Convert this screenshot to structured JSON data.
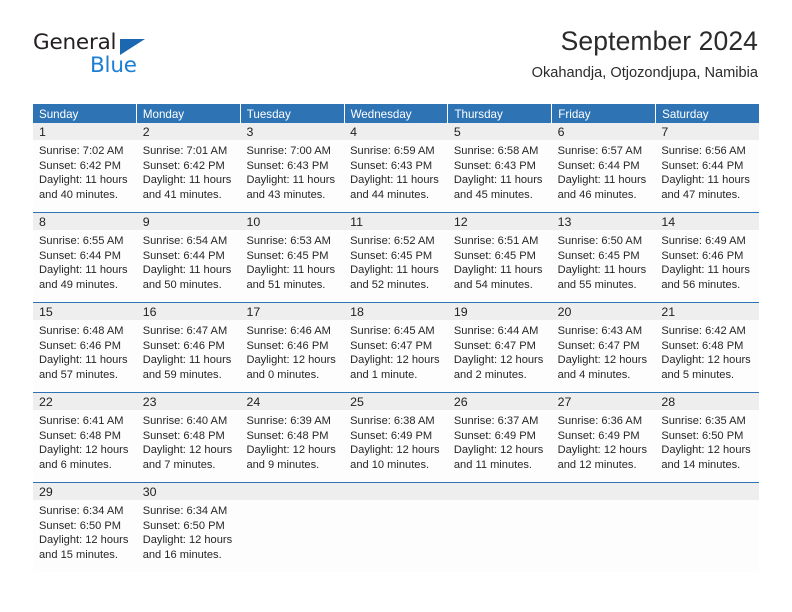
{
  "brand": {
    "name_top": "General",
    "name_bottom": "Blue",
    "triangle_color": "#1c68b0",
    "blue_color": "#1c7fd4"
  },
  "header": {
    "title": "September 2024",
    "subtitle": "Okahandja, Otjozondjupa, Namibia"
  },
  "theme": {
    "header_band": "#2e74b5",
    "daynum_band": "#eeeeee",
    "separator": "#2e74b5",
    "text": "#262626"
  },
  "calendar": {
    "weekdays": [
      "Sunday",
      "Monday",
      "Tuesday",
      "Wednesday",
      "Thursday",
      "Friday",
      "Saturday"
    ],
    "weeks": [
      [
        {
          "day": "1",
          "sunrise": "Sunrise: 7:02 AM",
          "sunset": "Sunset: 6:42 PM",
          "daylight1": "Daylight: 11 hours",
          "daylight2": "and 40 minutes."
        },
        {
          "day": "2",
          "sunrise": "Sunrise: 7:01 AM",
          "sunset": "Sunset: 6:42 PM",
          "daylight1": "Daylight: 11 hours",
          "daylight2": "and 41 minutes."
        },
        {
          "day": "3",
          "sunrise": "Sunrise: 7:00 AM",
          "sunset": "Sunset: 6:43 PM",
          "daylight1": "Daylight: 11 hours",
          "daylight2": "and 43 minutes."
        },
        {
          "day": "4",
          "sunrise": "Sunrise: 6:59 AM",
          "sunset": "Sunset: 6:43 PM",
          "daylight1": "Daylight: 11 hours",
          "daylight2": "and 44 minutes."
        },
        {
          "day": "5",
          "sunrise": "Sunrise: 6:58 AM",
          "sunset": "Sunset: 6:43 PM",
          "daylight1": "Daylight: 11 hours",
          "daylight2": "and 45 minutes."
        },
        {
          "day": "6",
          "sunrise": "Sunrise: 6:57 AM",
          "sunset": "Sunset: 6:44 PM",
          "daylight1": "Daylight: 11 hours",
          "daylight2": "and 46 minutes."
        },
        {
          "day": "7",
          "sunrise": "Sunrise: 6:56 AM",
          "sunset": "Sunset: 6:44 PM",
          "daylight1": "Daylight: 11 hours",
          "daylight2": "and 47 minutes."
        }
      ],
      [
        {
          "day": "8",
          "sunrise": "Sunrise: 6:55 AM",
          "sunset": "Sunset: 6:44 PM",
          "daylight1": "Daylight: 11 hours",
          "daylight2": "and 49 minutes."
        },
        {
          "day": "9",
          "sunrise": "Sunrise: 6:54 AM",
          "sunset": "Sunset: 6:44 PM",
          "daylight1": "Daylight: 11 hours",
          "daylight2": "and 50 minutes."
        },
        {
          "day": "10",
          "sunrise": "Sunrise: 6:53 AM",
          "sunset": "Sunset: 6:45 PM",
          "daylight1": "Daylight: 11 hours",
          "daylight2": "and 51 minutes."
        },
        {
          "day": "11",
          "sunrise": "Sunrise: 6:52 AM",
          "sunset": "Sunset: 6:45 PM",
          "daylight1": "Daylight: 11 hours",
          "daylight2": "and 52 minutes."
        },
        {
          "day": "12",
          "sunrise": "Sunrise: 6:51 AM",
          "sunset": "Sunset: 6:45 PM",
          "daylight1": "Daylight: 11 hours",
          "daylight2": "and 54 minutes."
        },
        {
          "day": "13",
          "sunrise": "Sunrise: 6:50 AM",
          "sunset": "Sunset: 6:45 PM",
          "daylight1": "Daylight: 11 hours",
          "daylight2": "and 55 minutes."
        },
        {
          "day": "14",
          "sunrise": "Sunrise: 6:49 AM",
          "sunset": "Sunset: 6:46 PM",
          "daylight1": "Daylight: 11 hours",
          "daylight2": "and 56 minutes."
        }
      ],
      [
        {
          "day": "15",
          "sunrise": "Sunrise: 6:48 AM",
          "sunset": "Sunset: 6:46 PM",
          "daylight1": "Daylight: 11 hours",
          "daylight2": "and 57 minutes."
        },
        {
          "day": "16",
          "sunrise": "Sunrise: 6:47 AM",
          "sunset": "Sunset: 6:46 PM",
          "daylight1": "Daylight: 11 hours",
          "daylight2": "and 59 minutes."
        },
        {
          "day": "17",
          "sunrise": "Sunrise: 6:46 AM",
          "sunset": "Sunset: 6:46 PM",
          "daylight1": "Daylight: 12 hours",
          "daylight2": "and 0 minutes."
        },
        {
          "day": "18",
          "sunrise": "Sunrise: 6:45 AM",
          "sunset": "Sunset: 6:47 PM",
          "daylight1": "Daylight: 12 hours",
          "daylight2": "and 1 minute."
        },
        {
          "day": "19",
          "sunrise": "Sunrise: 6:44 AM",
          "sunset": "Sunset: 6:47 PM",
          "daylight1": "Daylight: 12 hours",
          "daylight2": "and 2 minutes."
        },
        {
          "day": "20",
          "sunrise": "Sunrise: 6:43 AM",
          "sunset": "Sunset: 6:47 PM",
          "daylight1": "Daylight: 12 hours",
          "daylight2": "and 4 minutes."
        },
        {
          "day": "21",
          "sunrise": "Sunrise: 6:42 AM",
          "sunset": "Sunset: 6:48 PM",
          "daylight1": "Daylight: 12 hours",
          "daylight2": "and 5 minutes."
        }
      ],
      [
        {
          "day": "22",
          "sunrise": "Sunrise: 6:41 AM",
          "sunset": "Sunset: 6:48 PM",
          "daylight1": "Daylight: 12 hours",
          "daylight2": "and 6 minutes."
        },
        {
          "day": "23",
          "sunrise": "Sunrise: 6:40 AM",
          "sunset": "Sunset: 6:48 PM",
          "daylight1": "Daylight: 12 hours",
          "daylight2": "and 7 minutes."
        },
        {
          "day": "24",
          "sunrise": "Sunrise: 6:39 AM",
          "sunset": "Sunset: 6:48 PM",
          "daylight1": "Daylight: 12 hours",
          "daylight2": "and 9 minutes."
        },
        {
          "day": "25",
          "sunrise": "Sunrise: 6:38 AM",
          "sunset": "Sunset: 6:49 PM",
          "daylight1": "Daylight: 12 hours",
          "daylight2": "and 10 minutes."
        },
        {
          "day": "26",
          "sunrise": "Sunrise: 6:37 AM",
          "sunset": "Sunset: 6:49 PM",
          "daylight1": "Daylight: 12 hours",
          "daylight2": "and 11 minutes."
        },
        {
          "day": "27",
          "sunrise": "Sunrise: 6:36 AM",
          "sunset": "Sunset: 6:49 PM",
          "daylight1": "Daylight: 12 hours",
          "daylight2": "and 12 minutes."
        },
        {
          "day": "28",
          "sunrise": "Sunrise: 6:35 AM",
          "sunset": "Sunset: 6:50 PM",
          "daylight1": "Daylight: 12 hours",
          "daylight2": "and 14 minutes."
        }
      ],
      [
        {
          "day": "29",
          "sunrise": "Sunrise: 6:34 AM",
          "sunset": "Sunset: 6:50 PM",
          "daylight1": "Daylight: 12 hours",
          "daylight2": "and 15 minutes."
        },
        {
          "day": "30",
          "sunrise": "Sunrise: 6:34 AM",
          "sunset": "Sunset: 6:50 PM",
          "daylight1": "Daylight: 12 hours",
          "daylight2": "and 16 minutes."
        },
        {
          "day": "",
          "sunrise": "",
          "sunset": "",
          "daylight1": "",
          "daylight2": ""
        },
        {
          "day": "",
          "sunrise": "",
          "sunset": "",
          "daylight1": "",
          "daylight2": ""
        },
        {
          "day": "",
          "sunrise": "",
          "sunset": "",
          "daylight1": "",
          "daylight2": ""
        },
        {
          "day": "",
          "sunrise": "",
          "sunset": "",
          "daylight1": "",
          "daylight2": ""
        },
        {
          "day": "",
          "sunrise": "",
          "sunset": "",
          "daylight1": "",
          "daylight2": ""
        }
      ]
    ]
  }
}
